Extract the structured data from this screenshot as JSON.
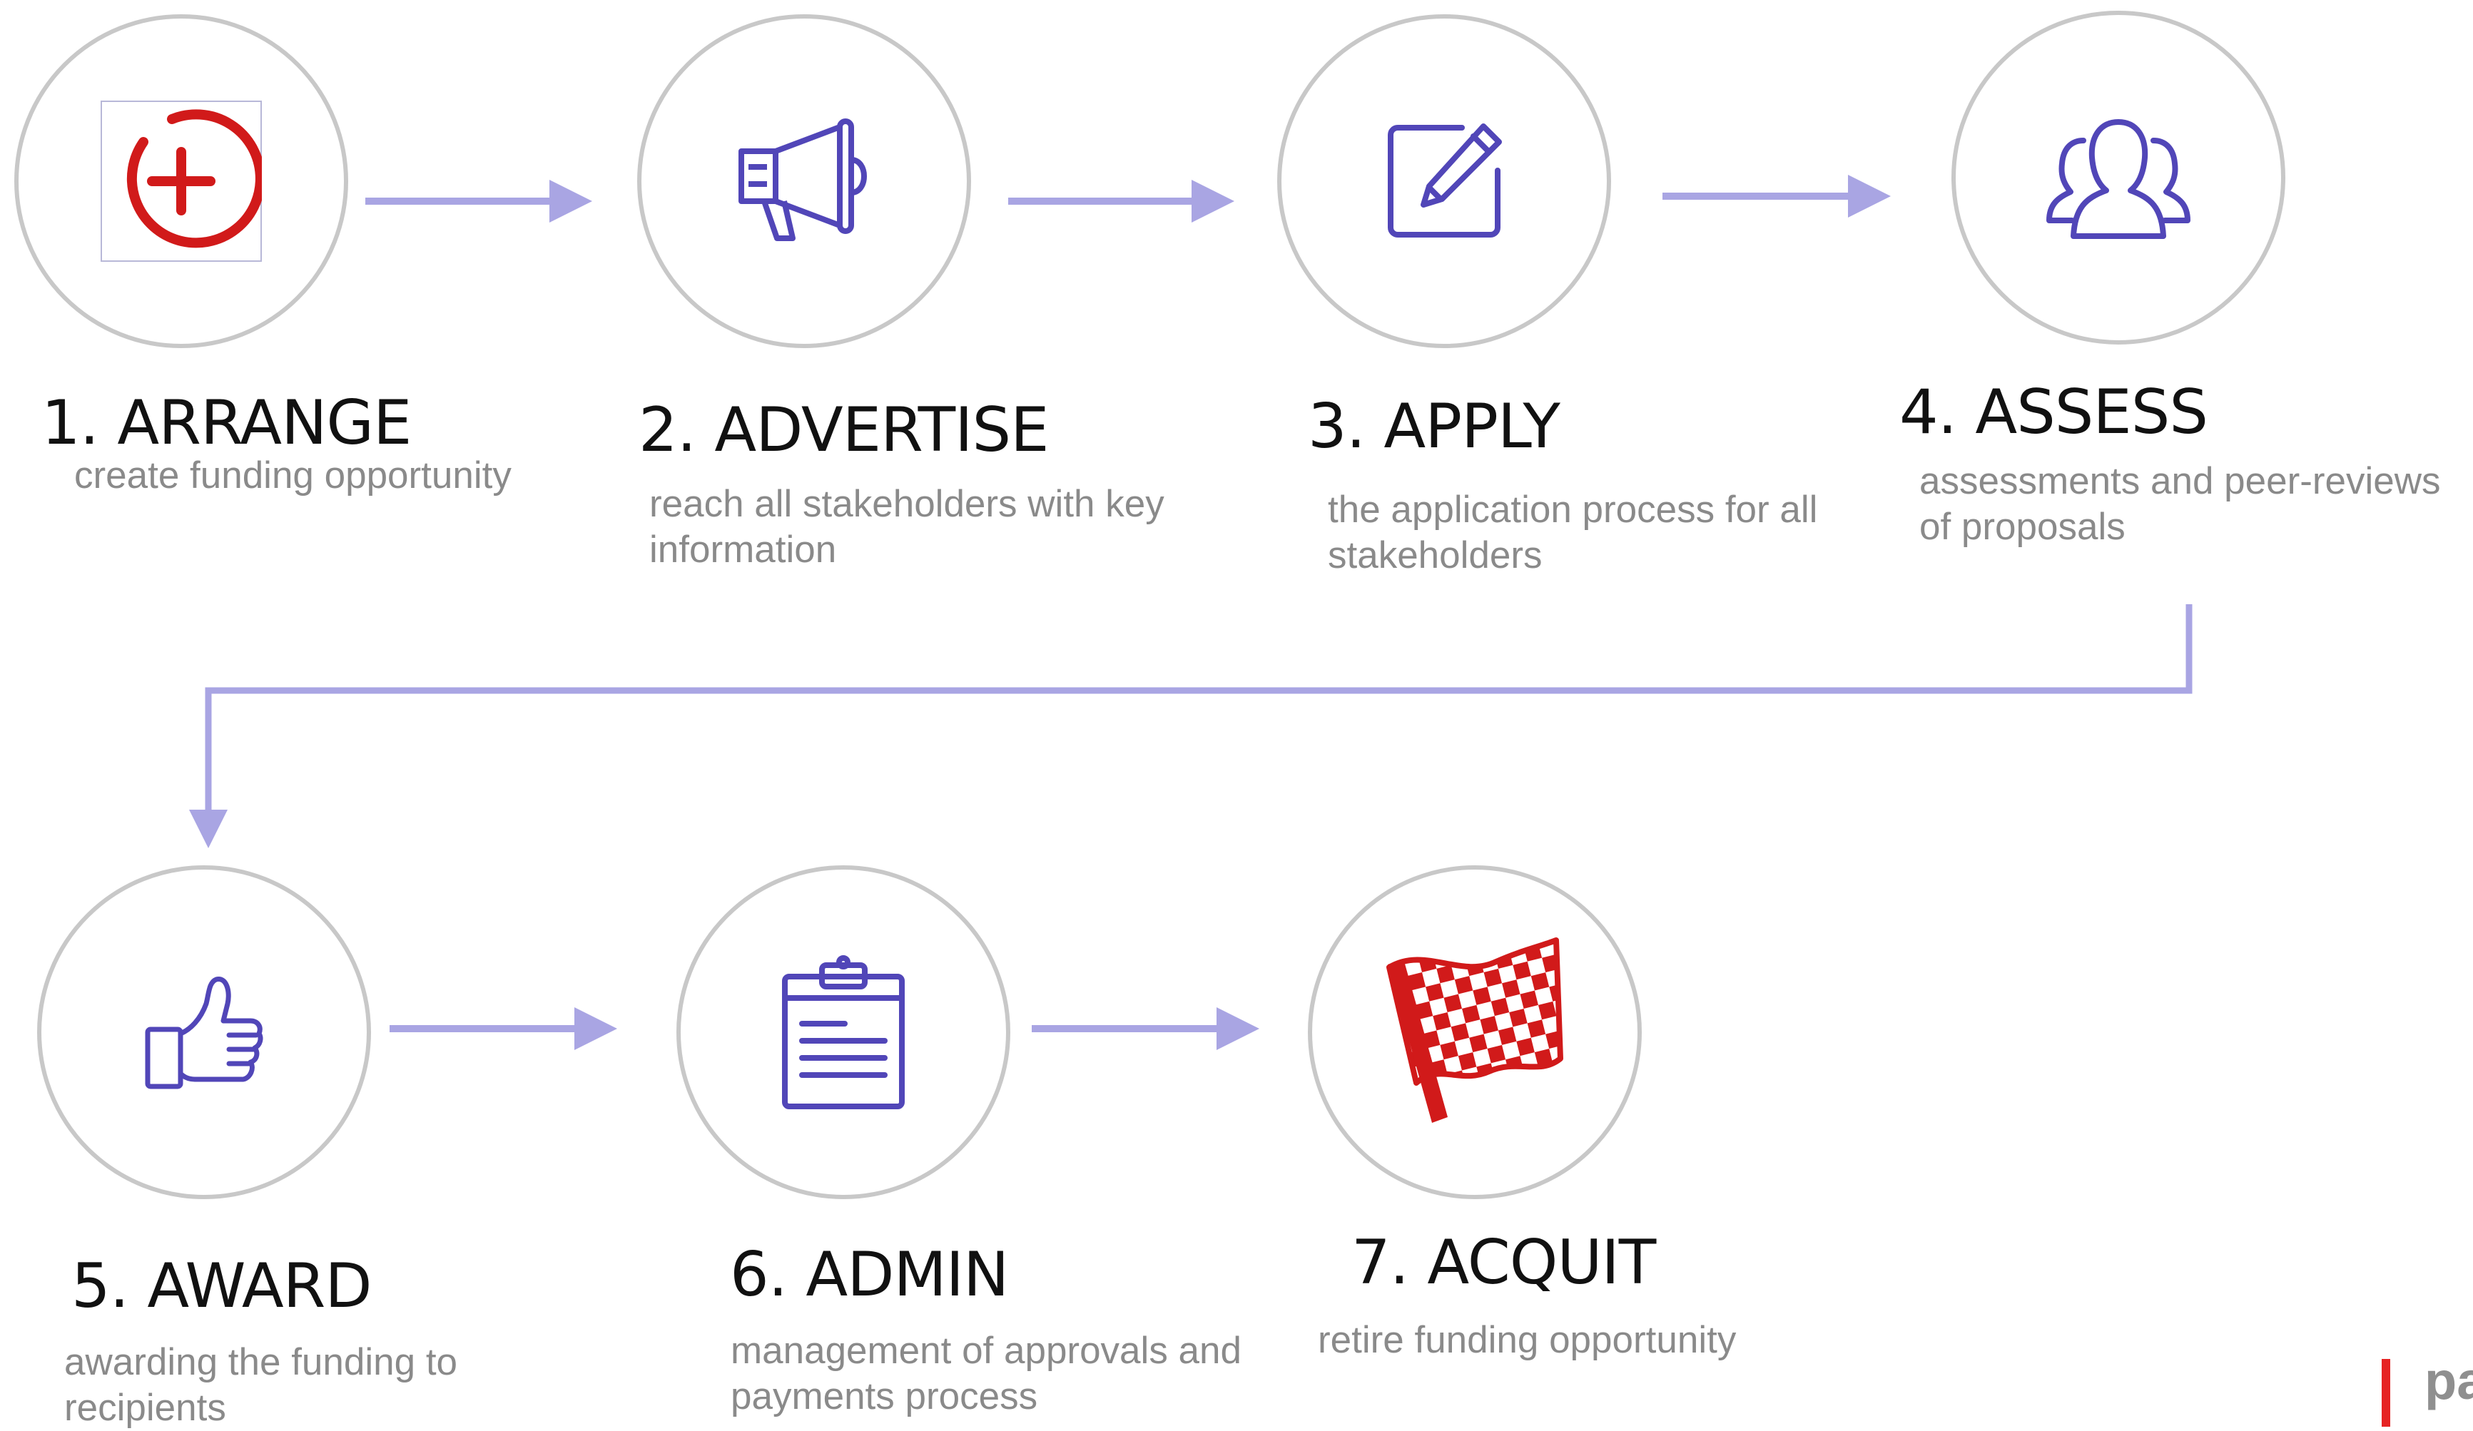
{
  "colors": {
    "connector": "#a9a5e3",
    "icon_purple": "#5146b8",
    "accent_red": "#d11a1a",
    "circle_border": "#c8c8c8",
    "desc_gray": "#8a8a8a"
  },
  "steps": [
    {
      "title": "1. ARRANGE",
      "description": "create funding opportunity",
      "icon": "add-circle-icon"
    },
    {
      "title": "2. ADVERTISE",
      "description": "reach all stakeholders with key information",
      "icon": "megaphone-icon"
    },
    {
      "title": "3. APPLY",
      "description": "the application process for all stakeholders",
      "icon": "edit-form-icon"
    },
    {
      "title": "4. ASSESS",
      "description": "assessments and peer-reviews of proposals",
      "icon": "people-group-icon"
    },
    {
      "title": "5. AWARD",
      "description": "awarding the funding to recipients",
      "icon": "thumbs-up-icon"
    },
    {
      "title": "6. ADMIN",
      "description": "management of  approvals and payments process",
      "icon": "clipboard-icon"
    },
    {
      "title": "7. ACQUIT",
      "description": "retire funding opportunity",
      "icon": "checkered-flag-icon"
    }
  ],
  "logo_text": "pa"
}
